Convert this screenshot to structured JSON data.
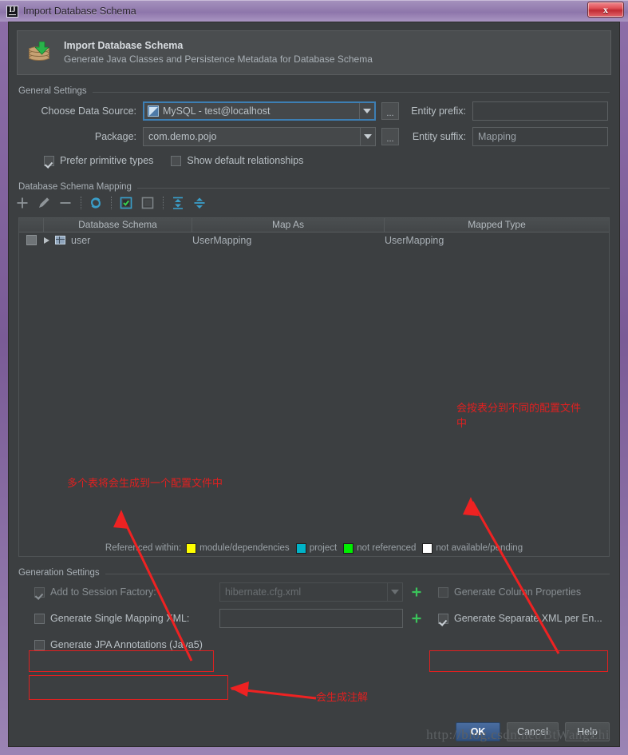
{
  "window": {
    "title": "Import Database Schema",
    "app_icon": "intellij-idea-icon",
    "close_label": "x"
  },
  "banner": {
    "icon": "database-import-icon",
    "title": "Import Database Schema",
    "subtitle": "Generate Java Classes and Persistence Metadata for Database Schema"
  },
  "general_settings": {
    "legend": "General Settings",
    "data_source_label": "Choose Data Source:",
    "data_source_value": "MySQL - test@localhost",
    "data_source_icon": "datasource-icon",
    "package_label": "Package:",
    "package_value": "com.demo.pojo",
    "browse_label": "...",
    "entity_prefix_label": "Entity prefix:",
    "entity_prefix_value": "",
    "entity_suffix_label": "Entity suffix:",
    "entity_suffix_value": "Mapping",
    "prefer_primitive_types": {
      "label": "Prefer primitive types",
      "checked": true
    },
    "show_default_relationships": {
      "label": "Show default relationships",
      "checked": false
    }
  },
  "schema_mapping": {
    "legend": "Database Schema Mapping",
    "toolbar": [
      {
        "name": "add-icon",
        "glyph": "+"
      },
      {
        "name": "edit-pencil-icon",
        "glyph": "pencil"
      },
      {
        "name": "remove-icon",
        "glyph": "−"
      },
      {
        "name": "refresh-icon",
        "glyph": "refresh"
      },
      {
        "name": "select-all-icon",
        "glyph": "checkbox-checked"
      },
      {
        "name": "deselect-all-icon",
        "glyph": "checkbox-empty"
      },
      {
        "name": "expand-all-icon",
        "glyph": "expand"
      },
      {
        "name": "collapse-all-icon",
        "glyph": "collapse"
      }
    ],
    "columns": [
      "Database Schema",
      "Map As",
      "Mapped Type"
    ],
    "rows": [
      {
        "selected": true,
        "expandable": true,
        "icon": "table-icon",
        "schema": "user",
        "map_as": "UserMapping",
        "mapped_type": "UserMapping"
      }
    ],
    "legend_strip": {
      "label": "Referenced within:",
      "items": [
        {
          "color": "#ffff00",
          "label": "module/dependencies"
        },
        {
          "color": "#00b3c8",
          "label": "project"
        },
        {
          "color": "#00ee00",
          "label": "not referenced"
        },
        {
          "color": "#ffffff",
          "label": "not available/pending"
        }
      ]
    }
  },
  "generation_settings": {
    "legend": "Generation Settings",
    "add_to_session_factory": {
      "label": "Add to Session Factory:",
      "checked": true,
      "disabled": true
    },
    "session_factory_value": "hibernate.cfg.xml",
    "generate_single_mapping_xml": {
      "label": "Generate Single Mapping XML:",
      "checked": false
    },
    "single_mapping_value": "",
    "generate_jpa_annotations": {
      "label": "Generate JPA Annotations (Java5)",
      "checked": false
    },
    "generate_column_properties": {
      "label": "Generate Column Properties",
      "checked": false,
      "disabled": true
    },
    "generate_separate_xml": {
      "label": "Generate Separate XML per En...",
      "checked": true
    },
    "plus_button_label": "+"
  },
  "buttons": {
    "ok": "OK",
    "cancel": "Cancel",
    "help": "Help"
  },
  "watermark": "http://blog.csdn.net/BtWangZhi",
  "annotations": [
    {
      "name": "annotation-separate-files",
      "text": "会按表分到不同的配置文件\n中",
      "color": "#e02020"
    },
    {
      "name": "annotation-single-file",
      "text": "多个表将会生成到一个配置文件中",
      "color": "#e02020"
    },
    {
      "name": "annotation-annotations",
      "text": "会生成注解",
      "color": "#e02020"
    }
  ]
}
